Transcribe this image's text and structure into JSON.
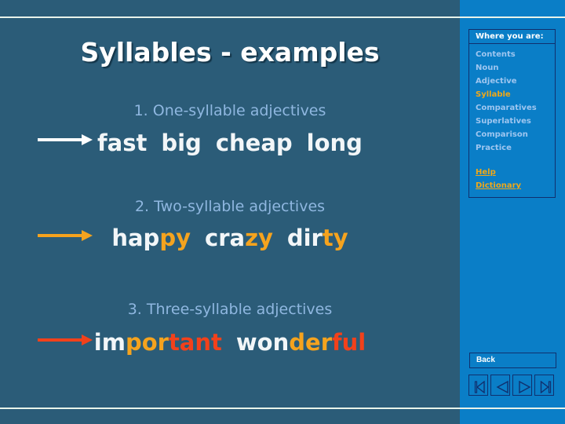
{
  "slide": {
    "title": "Syllables - examples",
    "sections": [
      {
        "heading": "1.  One-syllable adjectives",
        "arrow_color": "#ffffff",
        "words": [
          {
            "parts": [
              {
                "text": "fast",
                "tone": "white"
              }
            ]
          },
          {
            "parts": [
              {
                "text": "big",
                "tone": "white"
              }
            ]
          },
          {
            "parts": [
              {
                "text": "cheap",
                "tone": "white"
              }
            ]
          },
          {
            "parts": [
              {
                "text": "long",
                "tone": "white"
              }
            ]
          }
        ]
      },
      {
        "heading": "2.  Two-syllable adjectives",
        "arrow_color": "#f5a31e",
        "words": [
          {
            "parts": [
              {
                "text": "hap",
                "tone": "white"
              },
              {
                "text": "py",
                "tone": "orange"
              }
            ]
          },
          {
            "parts": [
              {
                "text": "cra",
                "tone": "white"
              },
              {
                "text": "zy",
                "tone": "orange"
              }
            ]
          },
          {
            "parts": [
              {
                "text": "dir",
                "tone": "white"
              },
              {
                "text": "ty",
                "tone": "orange"
              }
            ]
          }
        ]
      },
      {
        "heading": "3. Three-syllable adjectives",
        "arrow_color": "#f2411b",
        "words": [
          {
            "parts": [
              {
                "text": "im",
                "tone": "white"
              },
              {
                "text": "por",
                "tone": "orange"
              },
              {
                "text": "tant",
                "tone": "red"
              }
            ]
          },
          {
            "parts": [
              {
                "text": "won",
                "tone": "white"
              },
              {
                "text": "der",
                "tone": "orange"
              },
              {
                "text": "ful",
                "tone": "red"
              }
            ]
          }
        ]
      }
    ]
  },
  "sidebar": {
    "where_you_are_label": "Where you are:",
    "nav_items": [
      {
        "label": "Contents",
        "current": false
      },
      {
        "label": "Noun",
        "current": false
      },
      {
        "label": "Adjective",
        "current": false
      },
      {
        "label": "Syllable",
        "current": true
      },
      {
        "label": "Comparatives",
        "current": false
      },
      {
        "label": "Superlatives",
        "current": false
      },
      {
        "label": "Comparison",
        "current": false
      },
      {
        "label": "Practice",
        "current": false
      }
    ],
    "utility_links": [
      {
        "label": "Help"
      },
      {
        "label": "Dictionary"
      }
    ],
    "back_label": "Back",
    "nav_buttons": [
      {
        "icon": "first-slide-icon",
        "label": "First"
      },
      {
        "icon": "previous-slide-icon",
        "label": "Previous"
      },
      {
        "icon": "next-slide-icon",
        "label": "Next"
      },
      {
        "icon": "last-slide-icon",
        "label": "Last"
      }
    ]
  },
  "colors": {
    "background": "#2b5c78",
    "sidebar": "#0a7ec7",
    "accent_gold": "#f0a818",
    "accent_orange": "#f5a31e",
    "accent_red": "#f2411b",
    "nav_link": "#9ec6f0",
    "heading_blue": "#8fb7e0",
    "rule": "#e8f3ea",
    "border_dark": "#10306e"
  }
}
